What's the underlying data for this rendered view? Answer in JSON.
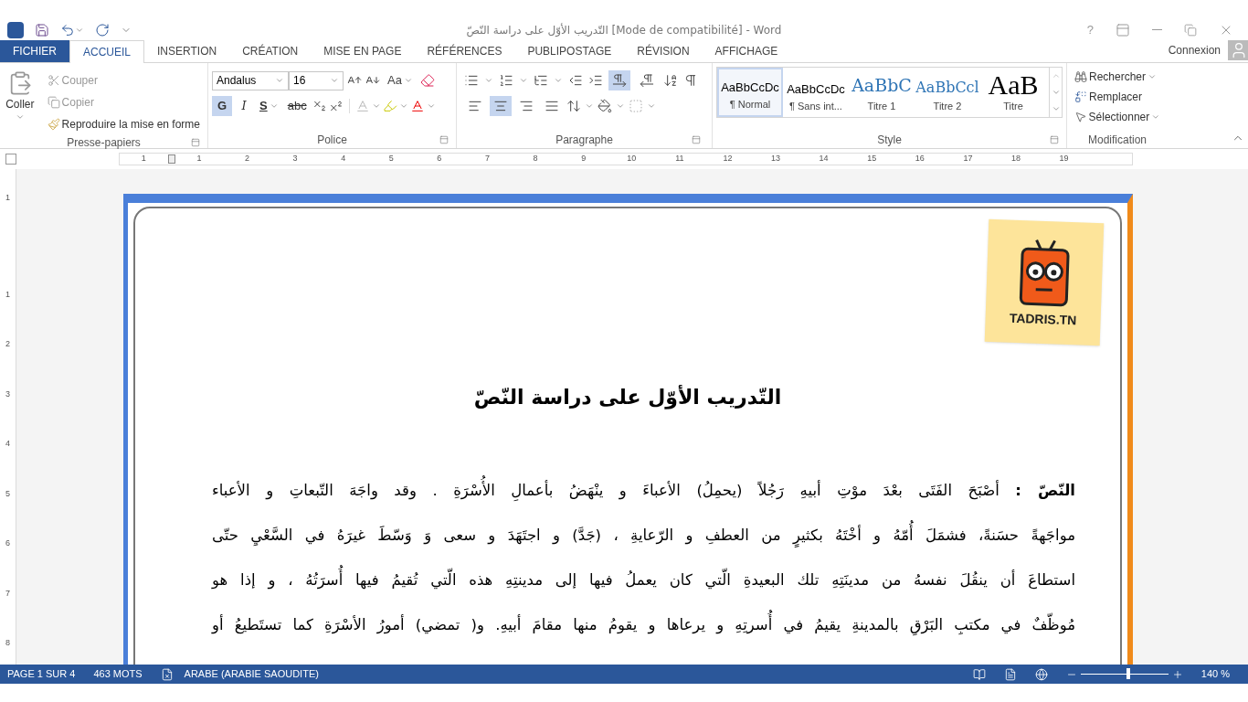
{
  "window": {
    "title": "التّدريب الأوّل على دراسة النّصّ [Mode de compatibilité] - Word",
    "help": "?"
  },
  "tabs": [
    {
      "label": "FICHIER",
      "kind": "file",
      "selected": false
    },
    {
      "label": "ACCUEIL",
      "kind": "tab",
      "selected": true
    },
    {
      "label": "INSERTION",
      "kind": "tab",
      "selected": false
    },
    {
      "label": "CRÉATION",
      "kind": "tab",
      "selected": false
    },
    {
      "label": "MISE EN PAGE",
      "kind": "tab",
      "selected": false
    },
    {
      "label": "RÉFÉRENCES",
      "kind": "tab",
      "selected": false
    },
    {
      "label": "PUBLIPOSTAGE",
      "kind": "tab",
      "selected": false
    },
    {
      "label": "RÉVISION",
      "kind": "tab",
      "selected": false
    },
    {
      "label": "AFFICHAGE",
      "kind": "tab",
      "selected": false
    }
  ],
  "account": {
    "label": "Connexion"
  },
  "clipboard": {
    "label": "Presse-papiers",
    "paste": "Coller",
    "cut": "Couper",
    "copy": "Copier",
    "format_painter": "Reproduire la mise en forme"
  },
  "font_group": {
    "label": "Police",
    "font": "Andalus",
    "size": "16",
    "case_button": "Aa",
    "format_buttons": [
      {
        "label": "G",
        "kind": "bold",
        "on": true
      },
      {
        "label": "I",
        "kind": "italic",
        "on": false
      },
      {
        "label": "S",
        "kind": "underline",
        "on": false
      },
      {
        "label": "abc",
        "kind": "strike",
        "on": false
      }
    ]
  },
  "paragraph_group": {
    "label": "Paragraphe",
    "direction_buttons": [
      {
        "kind": "ltr",
        "selected": true
      },
      {
        "kind": "rtl",
        "selected": false
      }
    ],
    "align_buttons": [
      {
        "kind": "left",
        "selected": false
      },
      {
        "kind": "center",
        "selected": true
      },
      {
        "kind": "right",
        "selected": false
      },
      {
        "kind": "justify",
        "selected": false
      }
    ]
  },
  "style_group": {
    "label": "Style",
    "styles": [
      {
        "preview": "AaBbCcDc",
        "name": "¶ Normal",
        "kind": "normal",
        "selected": true
      },
      {
        "preview": "AaBbCcDc",
        "name": "¶ Sans int...",
        "kind": "plain",
        "selected": false
      },
      {
        "preview": "AaBbC",
        "name": "Titre 1",
        "kind": "heading1",
        "selected": false
      },
      {
        "preview": "AaBbCcl",
        "name": "Titre 2",
        "kind": "heading2",
        "selected": false
      },
      {
        "preview": "AaB",
        "name": "Titre",
        "kind": "title",
        "selected": false
      }
    ]
  },
  "editing_group": {
    "label": "Modification",
    "find": "Rechercher",
    "replace": "Remplacer",
    "select": "Sélectionner"
  },
  "ruler": {
    "labels": [
      "1",
      "1",
      "2",
      "3",
      "4",
      "5",
      "6",
      "7",
      "8",
      "9",
      "10",
      "11",
      "12",
      "13",
      "14",
      "15",
      "16",
      "17",
      "18",
      "19"
    ]
  },
  "vertical_ruler": {
    "labels": [
      "1",
      "1",
      "2",
      "3",
      "4",
      "5",
      "6",
      "7",
      "8"
    ]
  },
  "document": {
    "logo_text": "TADRIS.TN",
    "title": "التّدريب الأوّل على دراسة النّصّ",
    "lines": [
      "**النّصّ :** أصْبَحَ الفَتَى بعْدَ موْتِ أبيهِ رَجُلاً (يحمِلُ) الأعباءَ و ينْهَضُ بأعمالِ الأُسْرَةِ . وقد واجَهَ التّبعاتِ و الأعباء",
      "مواجَهةً حسَنةً، فشمَلَ أُمّهُ و أخْتَهُ بكثيرٍ من العطفِ و الرّعايةِ ، (جَدَّ) و اجتَهَدَ و سعى وَ وَسّطَ غيرَهُ في السَّعْيِ حتّى",
      "استطاعَ أن ينقُلَ نفسهُ من مدينَتِهِ تلك البعيدةِ الّتي كان يعملُ فيها إلى مدينتِهِ هذه الّتي تُقيمُ فيها أُسرَتُهُ ، و إذا هو",
      "مُوظّفٌ في مكتبِ البَرْقِ بالمدينةِ يقيمُ في أُسرتِهِ و يرعاها و يقومُ منها مقامَ أبيهِ. و( تمضي) أمورُ الأسْرَةِ كما تستَطيعُ أو"
    ]
  },
  "status_bar": {
    "page": "PAGE 1 SUR 4",
    "words": "463 MOTS",
    "language": "ARABE (ARABIE SAOUDITE)",
    "zoom": "140 %",
    "zoom_slider": {
      "level": 0.54
    }
  }
}
